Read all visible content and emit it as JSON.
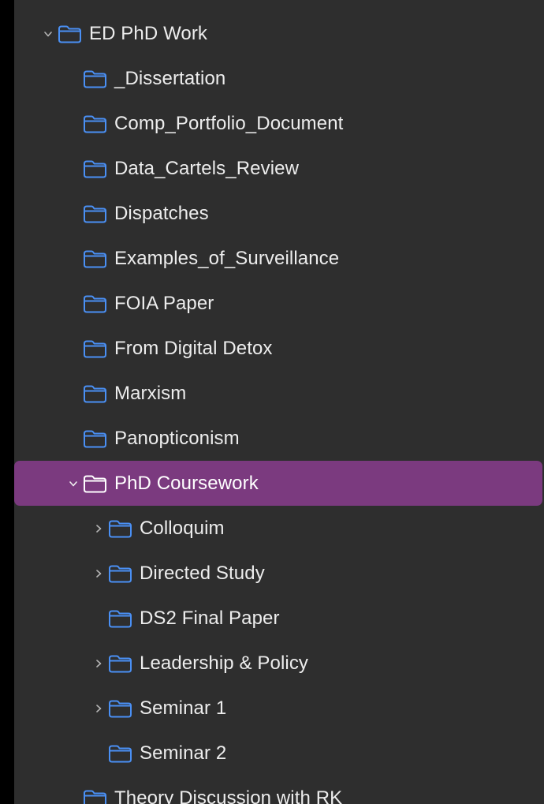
{
  "colors": {
    "background": "#2e2e2e",
    "selection": "#7b3a7f",
    "folder_icon": "#4a90f5",
    "text": "#ededed",
    "chevron": "#b5b5b5"
  },
  "tree": [
    {
      "label": "ED PhD Work",
      "depth": 0,
      "chevron": "expanded",
      "selected": false
    },
    {
      "label": "_Dissertation",
      "depth": 1,
      "chevron": "none",
      "selected": false
    },
    {
      "label": "Comp_Portfolio_Document",
      "depth": 1,
      "chevron": "none",
      "selected": false
    },
    {
      "label": "Data_Cartels_Review",
      "depth": 1,
      "chevron": "none",
      "selected": false
    },
    {
      "label": "Dispatches",
      "depth": 1,
      "chevron": "none",
      "selected": false
    },
    {
      "label": "Examples_of_Surveillance",
      "depth": 1,
      "chevron": "none",
      "selected": false
    },
    {
      "label": "FOIA Paper",
      "depth": 1,
      "chevron": "none",
      "selected": false
    },
    {
      "label": "From Digital Detox",
      "depth": 1,
      "chevron": "none",
      "selected": false
    },
    {
      "label": "Marxism",
      "depth": 1,
      "chevron": "none",
      "selected": false
    },
    {
      "label": "Panopticonism",
      "depth": 1,
      "chevron": "none",
      "selected": false
    },
    {
      "label": "PhD Coursework",
      "depth": 1,
      "chevron": "expanded",
      "selected": true
    },
    {
      "label": "Colloquim",
      "depth": 2,
      "chevron": "collapsed",
      "selected": false
    },
    {
      "label": "Directed Study",
      "depth": 2,
      "chevron": "collapsed",
      "selected": false
    },
    {
      "label": "DS2 Final Paper",
      "depth": 2,
      "chevron": "none",
      "selected": false
    },
    {
      "label": "Leadership & Policy",
      "depth": 2,
      "chevron": "collapsed",
      "selected": false
    },
    {
      "label": "Seminar 1",
      "depth": 2,
      "chevron": "collapsed",
      "selected": false
    },
    {
      "label": "Seminar 2",
      "depth": 2,
      "chevron": "none",
      "selected": false
    },
    {
      "label": "Theory Discussion with RK",
      "depth": 1,
      "chevron": "none",
      "selected": false
    }
  ]
}
